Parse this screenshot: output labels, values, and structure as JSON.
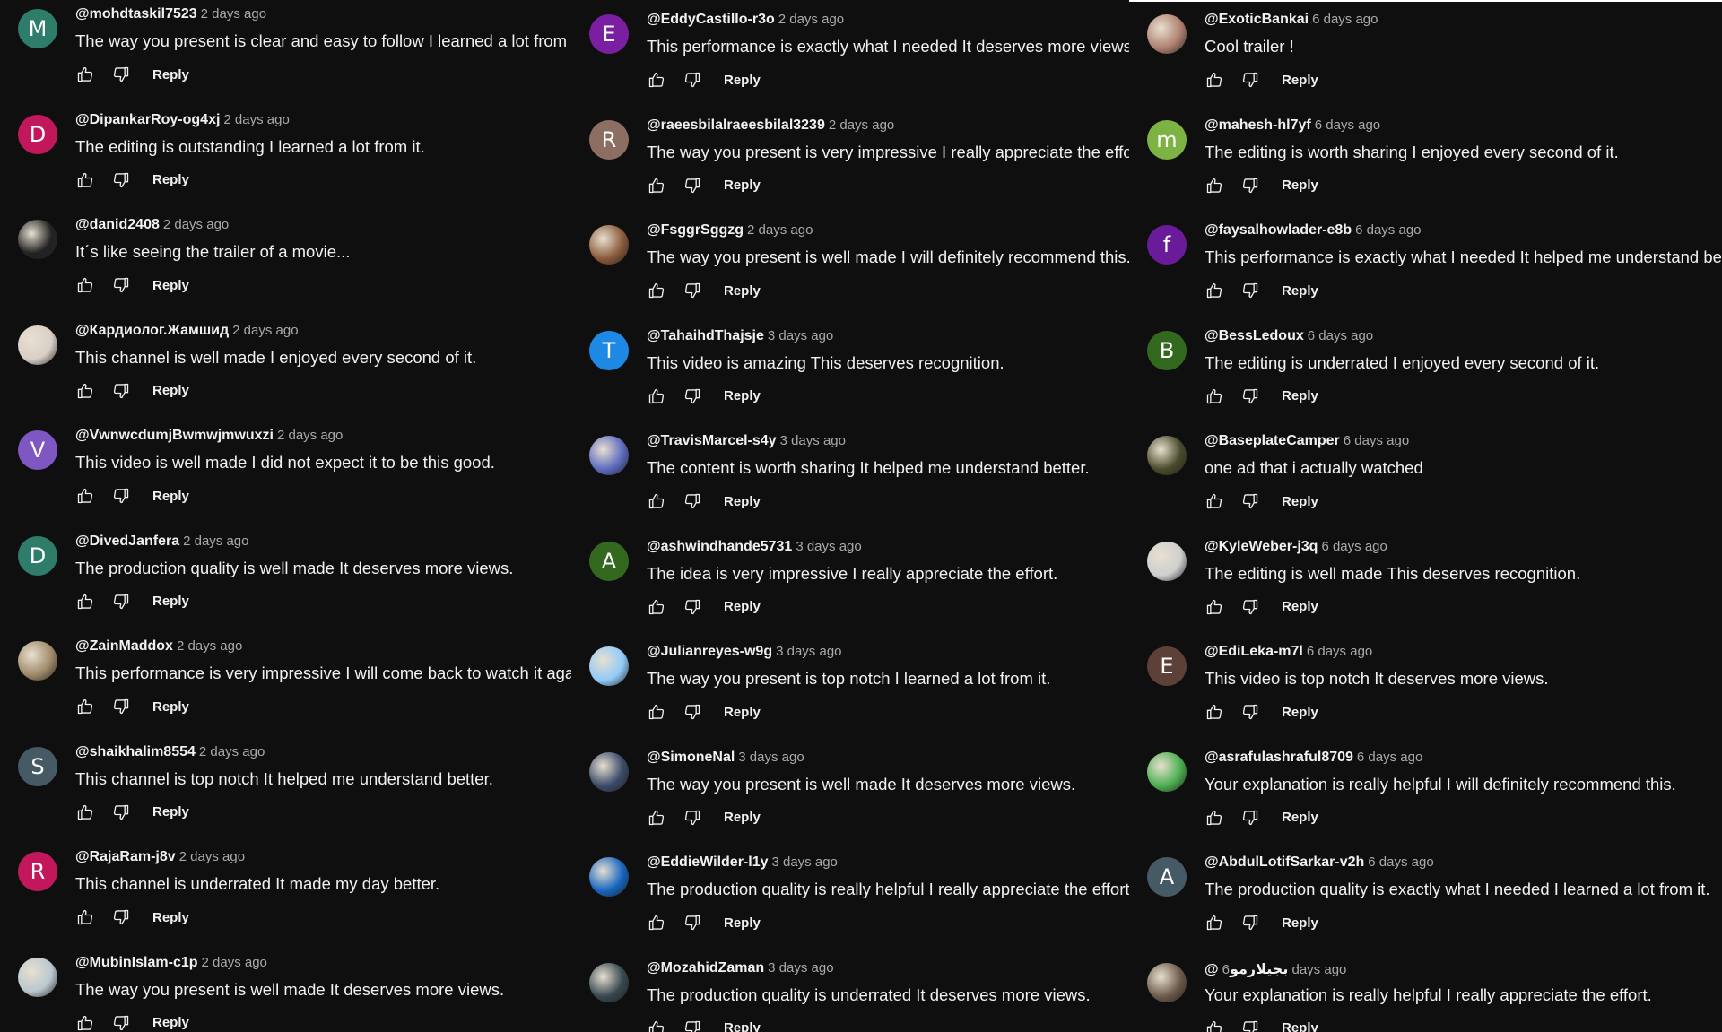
{
  "reply_label": "Reply",
  "columns": [
    {
      "offset_index": 0,
      "comments": [
        {
          "handle": "@mohdtaskil7523",
          "time": "2 days ago",
          "text": "The way you present is clear and easy to follow I learned a lot from it.",
          "avatar_letter": "M",
          "avatar_color": "#2e7d6b"
        },
        {
          "handle": "@DipankarRoy-og4xj",
          "time": "2 days ago",
          "text": "The editing is outstanding I learned a lot from it.",
          "avatar_letter": "D",
          "avatar_color": "#c2185b"
        },
        {
          "handle": "@danid2408",
          "time": "2 days ago",
          "text": "It´s like seeing the trailer of a movie...",
          "avatar_letter": "",
          "avatar_color": "#222222"
        },
        {
          "handle": "@Кардиолог.Жамшид",
          "time": "2 days ago",
          "text": "This channel is well made I enjoyed every second of it.",
          "avatar_letter": "",
          "avatar_color": "#d9cfc7"
        },
        {
          "handle": "@VwnwcdumjBwmwjmwuxzi",
          "time": "2 days ago",
          "text": "This video is well made I did not expect it to be this good.",
          "avatar_letter": "V",
          "avatar_color": "#7e57c2"
        },
        {
          "handle": "@DivedJanfera",
          "time": "2 days ago",
          "text": "The production quality is well made It deserves more views.",
          "avatar_letter": "D",
          "avatar_color": "#2e7d6b"
        },
        {
          "handle": "@ZainMaddox",
          "time": "2 days ago",
          "text": "This performance is very impressive I will come back to watch it again.",
          "avatar_letter": "",
          "avatar_color": "#a08a6a"
        },
        {
          "handle": "@shaikhalim8554",
          "time": "2 days ago",
          "text": "This channel is top notch It helped me understand better.",
          "avatar_letter": "S",
          "avatar_color": "#455a64"
        },
        {
          "handle": "@RajaRam-j8v",
          "time": "2 days ago",
          "text": "This channel is underrated It made my day better.",
          "avatar_letter": "R",
          "avatar_color": "#c2185b"
        },
        {
          "handle": "@MubinIslam-c1p",
          "time": "2 days ago",
          "text": "The way you present is well made It deserves more views.",
          "avatar_letter": "",
          "avatar_color": "#b9c7cf"
        }
      ]
    },
    {
      "offset_index": 1,
      "comments": [
        {
          "handle": "@EddyCastillo-r3o",
          "time": "2 days ago",
          "text": "This performance is exactly what I needed It deserves more views.",
          "avatar_letter": "E",
          "avatar_color": "#7b1fa2"
        },
        {
          "handle": "@raeesbilalraeesbilal3239",
          "time": "2 days ago",
          "text": "The way you present is very impressive I really appreciate the effort.",
          "avatar_letter": "R",
          "avatar_color": "#8d6e63"
        },
        {
          "handle": "@FsggrSggzg",
          "time": "2 days ago",
          "text": "The way you present is well made I will definitely recommend this.",
          "avatar_letter": "",
          "avatar_color": "#8a5a3a"
        },
        {
          "handle": "@TahaihdThajsje",
          "time": "3 days ago",
          "text": "This video is amazing This deserves recognition.",
          "avatar_letter": "T",
          "avatar_color": "#1e88e5"
        },
        {
          "handle": "@TravisMarcel-s4y",
          "time": "3 days ago",
          "text": "The content is worth sharing It helped me understand better.",
          "avatar_letter": "",
          "avatar_color": "#5c6bc0"
        },
        {
          "handle": "@ashwindhande5731",
          "time": "3 days ago",
          "text": "The idea is very impressive I really appreciate the effort.",
          "avatar_letter": "A",
          "avatar_color": "#33691e"
        },
        {
          "handle": "@Julianreyes-w9g",
          "time": "3 days ago",
          "text": "The way you present is top notch I learned a lot from it.",
          "avatar_letter": "",
          "avatar_color": "#90caf9"
        },
        {
          "handle": "@SimoneNal",
          "time": "3 days ago",
          "text": "The way you present is well made It deserves more views.",
          "avatar_letter": "",
          "avatar_color": "#3a4a6a"
        },
        {
          "handle": "@EddieWilder-l1y",
          "time": "3 days ago",
          "text": "The production quality is really helpful I really appreciate the effort.",
          "avatar_letter": "",
          "avatar_color": "#1565c0"
        },
        {
          "handle": "@MozahidZaman",
          "time": "3 days ago",
          "text": "The production quality is underrated It deserves more views.",
          "avatar_letter": "",
          "avatar_color": "#37474f"
        }
      ]
    },
    {
      "offset_index": 1,
      "comments": [
        {
          "handle": "@ExoticBankai",
          "time": "6 days ago",
          "text": "Cool trailer !",
          "avatar_letter": "",
          "avatar_color": "#b08070"
        },
        {
          "handle": "@mahesh-hl7yf",
          "time": "6 days ago",
          "text": "The editing is worth sharing I enjoyed every second of it.",
          "avatar_letter": "m",
          "avatar_color": "#7cb342"
        },
        {
          "handle": "@faysalhowlader-e8b",
          "time": "6 days ago",
          "text": "This performance is exactly what I needed It helped me understand better.",
          "avatar_letter": "f",
          "avatar_color": "#6a1b9a"
        },
        {
          "handle": "@BessLedoux",
          "time": "6 days ago",
          "text": "The editing is underrated I enjoyed every second of it.",
          "avatar_letter": "B",
          "avatar_color": "#33691e"
        },
        {
          "handle": "@BaseplateCamper",
          "time": "6 days ago",
          "text": "one ad that i actually watched",
          "avatar_letter": "",
          "avatar_color": "#4a4a2a"
        },
        {
          "handle": "@KyleWeber-j3q",
          "time": "6 days ago",
          "text": "The editing is well made This deserves recognition.",
          "avatar_letter": "",
          "avatar_color": "#cfcfcf"
        },
        {
          "handle": "@EdiLeka-m7l",
          "time": "6 days ago",
          "text": "This video is top notch It deserves more views.",
          "avatar_letter": "E",
          "avatar_color": "#5d4037"
        },
        {
          "handle": "@asrafulashraful8709",
          "time": "6 days ago",
          "text": "Your explanation is really helpful I will definitely recommend this.",
          "avatar_letter": "",
          "avatar_color": "#4caf50"
        },
        {
          "handle": "@AbdulLotifSarkar-v2h",
          "time": "6 days ago",
          "text": "The production quality is exactly what I needed I learned a lot from it.",
          "avatar_letter": "A",
          "avatar_color": "#455a64"
        },
        {
          "handle": "@بجيلارمو",
          "time": "6 days ago",
          "text": "Your explanation is really helpful I really appreciate the effort.",
          "avatar_letter": "",
          "avatar_color": "#6d5a4a"
        }
      ]
    }
  ]
}
